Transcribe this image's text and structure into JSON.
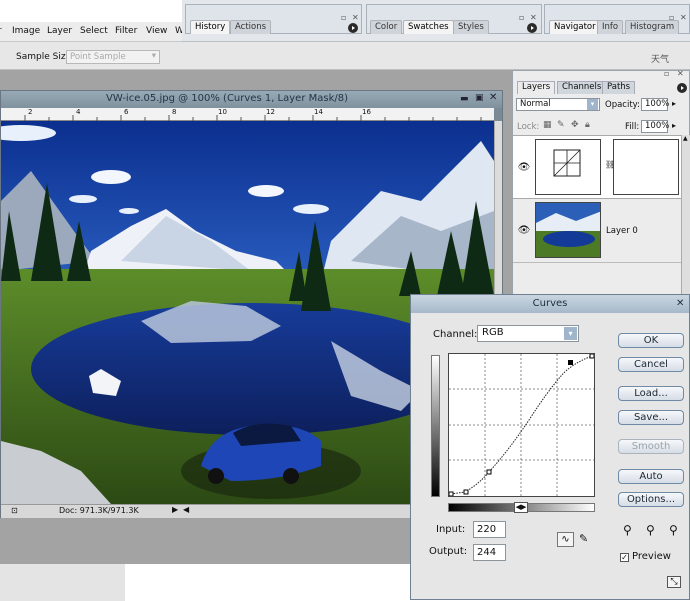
{
  "menubar": [
    "Image",
    "Layer",
    "Select",
    "Filter",
    "View",
    "W"
  ],
  "options_bar": {
    "sample_size_label": "Sample Size:",
    "sample_size_value": "Point Sample"
  },
  "panels_top": {
    "group1_tabs": [
      "History",
      "Actions"
    ],
    "group2_tabs": [
      "Color",
      "Swatches",
      "Styles"
    ],
    "group3_tabs": [
      "Navigator",
      "Info",
      "Histogram"
    ],
    "partial_text": "天气"
  },
  "document": {
    "title": "VW-ice.05.jpg @ 100% (Curves 1, Layer Mask/8)",
    "ruler_numbers": [
      "2",
      "4",
      "6",
      "8",
      "10",
      "12",
      "14",
      "16"
    ],
    "status_doc": "Doc: 971.3K/971.3K"
  },
  "layers": {
    "tabs": [
      "Layers",
      "Channels",
      "Paths"
    ],
    "blend_mode": "Normal",
    "opacity_label": "Opacity:",
    "opacity_value": "100%",
    "lock_label": "Lock:",
    "fill_label": "Fill:",
    "fill_value": "100%",
    "layer0_name": "Layer 0"
  },
  "curves": {
    "title": "Curves",
    "channel_label": "Channel:",
    "channel_value": "RGB",
    "buttons": {
      "ok": "OK",
      "cancel": "Cancel",
      "load": "Load...",
      "save": "Save...",
      "smooth": "Smooth",
      "auto": "Auto",
      "options": "Options..."
    },
    "input_label": "Input:",
    "input_value": "220",
    "output_label": "Output:",
    "output_value": "244",
    "preview_label": "Preview",
    "preview_checked": true
  },
  "colors": {
    "dialog_bg": "#e6e6e6",
    "button_border": "#6f8aa5",
    "workspace": "#a3a3a3"
  }
}
